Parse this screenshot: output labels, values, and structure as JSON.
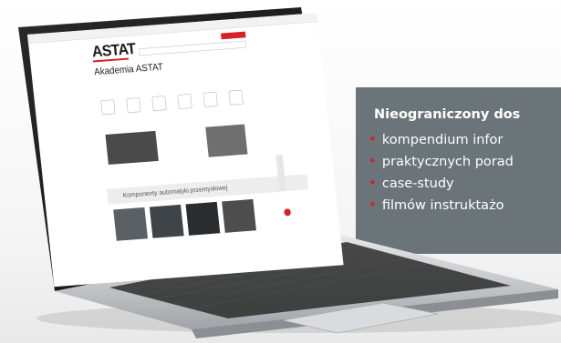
{
  "info_panel": {
    "title": "Nieograniczony dos",
    "items": [
      {
        "bullet": "•",
        "text": "kompendium infor"
      },
      {
        "bullet": "•",
        "text": "praktycznych porad"
      },
      {
        "bullet": "•",
        "text": "case-study"
      },
      {
        "bullet": "•",
        "text": "filmów instruktażo"
      }
    ]
  },
  "website": {
    "logo": "ASTAT",
    "page_heading": "Akademia ASTAT",
    "products_band_label": "Komponenty automatyki przemysłowej"
  },
  "colors": {
    "panel_gray": "#6b7479",
    "accent_red": "#d6202a",
    "laptop_silver": "#c9ccce"
  }
}
